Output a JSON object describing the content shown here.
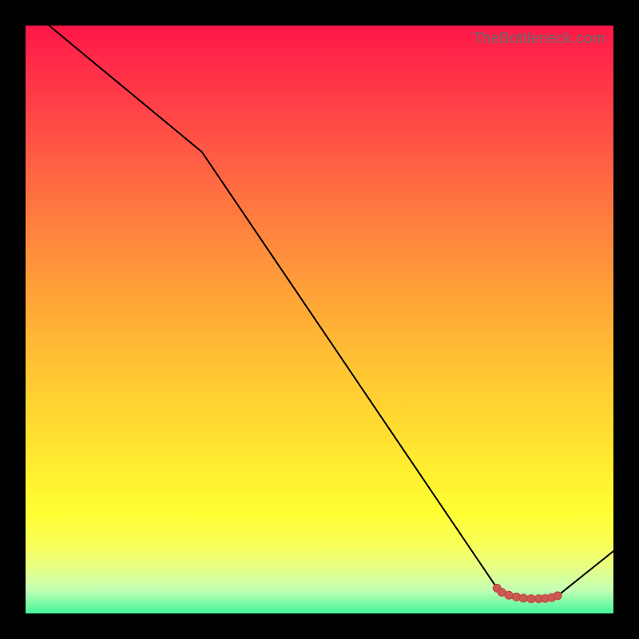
{
  "watermark": "TheBottleneck.com",
  "colors": {
    "line": "#000000",
    "highlight_stroke": "#c1483f",
    "highlight_fill": "#c95952"
  },
  "chart_data": {
    "type": "line",
    "title": "",
    "xlabel": "",
    "ylabel": "",
    "xlim": [
      0,
      100
    ],
    "ylim": [
      0,
      100
    ],
    "series": [
      {
        "name": "curve",
        "x": [
          4,
          30,
          80.2,
          81,
          82.2,
          83.5,
          84.7,
          86,
          87.3,
          88.4,
          89.5,
          90.5,
          100
        ],
        "y": [
          100,
          78.5,
          4.3,
          3.6,
          3.1,
          2.8,
          2.6,
          2.5,
          2.5,
          2.55,
          2.7,
          3.0,
          10.6
        ]
      }
    ],
    "highlight_segment": {
      "x": [
        80.2,
        81,
        82.2,
        83.5,
        84.7,
        86,
        87.3,
        88.4,
        89.5,
        90.5
      ],
      "y": [
        4.3,
        3.6,
        3.1,
        2.8,
        2.6,
        2.5,
        2.5,
        2.55,
        2.7,
        3.0
      ]
    }
  }
}
